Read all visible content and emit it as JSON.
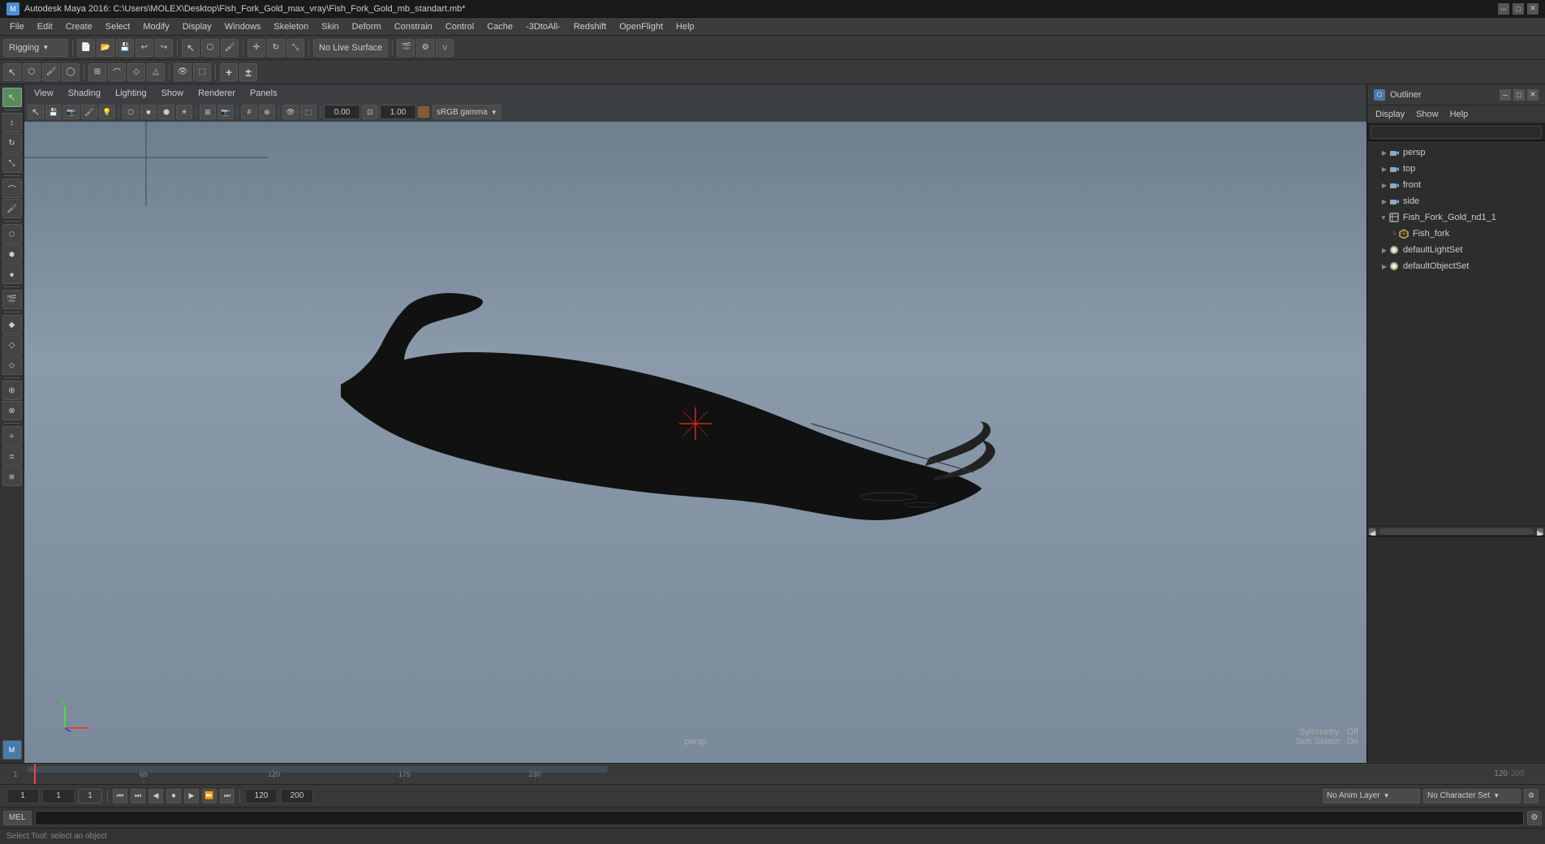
{
  "window": {
    "title": "Autodesk Maya 2016: C:\\Users\\MOLEX\\Desktop\\Fish_Fork_Gold_max_vray\\Fish_Fork_Gold_mb_standart.mb*",
    "icon": "M"
  },
  "menu": {
    "items": [
      "File",
      "Edit",
      "Create",
      "Select",
      "Modify",
      "Display",
      "Windows",
      "Skeleton",
      "Skin",
      "Deform",
      "Constrain",
      "Control",
      "Cache",
      "-3DtoAll-",
      "Redshift",
      "OpenFlight",
      "Help"
    ]
  },
  "toolbar": {
    "rigging_dropdown": "Rigging",
    "no_live_surface": "No Live Surface"
  },
  "viewport_menu": {
    "items": [
      "View",
      "Shading",
      "Lighting",
      "Show",
      "Renderer",
      "Panels"
    ]
  },
  "viewport": {
    "persp_label": "persp",
    "symmetry_label": "Symmetry:",
    "symmetry_value": "Off",
    "soft_select_label": "Soft Select:",
    "soft_select_value": "On",
    "gamma_value": "sRGB gamma",
    "value1": "0.00",
    "value2": "1.00"
  },
  "outliner": {
    "title": "Outliner",
    "menus": [
      "Display",
      "Show",
      "Help"
    ],
    "tree_items": [
      {
        "id": "persp",
        "label": "persp",
        "type": "camera",
        "indent": 0,
        "expanded": false
      },
      {
        "id": "top",
        "label": "top",
        "type": "camera",
        "indent": 0,
        "expanded": false
      },
      {
        "id": "front",
        "label": "front",
        "type": "camera",
        "indent": 0,
        "expanded": false
      },
      {
        "id": "side",
        "label": "side",
        "type": "camera",
        "indent": 0,
        "expanded": false
      },
      {
        "id": "fish_fork_gold",
        "label": "Fish_Fork_Gold_nd1_1",
        "type": "group",
        "indent": 0,
        "expanded": true
      },
      {
        "id": "fish_fork",
        "label": "Fish_fork",
        "type": "mesh",
        "indent": 1,
        "expanded": false
      },
      {
        "id": "defaultLightSet",
        "label": "defaultLightSet",
        "type": "lightset",
        "indent": 0,
        "expanded": false
      },
      {
        "id": "defaultObjectSet",
        "label": "defaultObjectSet",
        "type": "objset",
        "indent": 0,
        "expanded": false
      }
    ]
  },
  "timeline": {
    "start_frame": "1",
    "end_frame": "120",
    "current_frame": "1",
    "range_start": "1",
    "range_end": "200",
    "ticks": [
      {
        "pos": 3,
        "label": "65"
      },
      {
        "pos": 8,
        "label": "120"
      },
      {
        "pos": 12,
        "label": "175"
      }
    ],
    "frame_labels": [
      "65",
      "120",
      "175",
      "230"
    ]
  },
  "transport": {
    "buttons": [
      "⏮",
      "⏭",
      "◀◀",
      "▶▶",
      "◀",
      "▶",
      "⏹",
      "▶▶"
    ],
    "anim_layer": "No Anim Layer",
    "character_set": "No Character Set"
  },
  "mel": {
    "tab_label": "MEL",
    "placeholder": ""
  },
  "status_bar": {
    "message": "Select Tool: select an object"
  },
  "icons": {
    "camera_icon": "📷",
    "mesh_icon": "⬡",
    "group_icon": "⊞",
    "lightset_icon": "●",
    "objset_icon": "●"
  }
}
